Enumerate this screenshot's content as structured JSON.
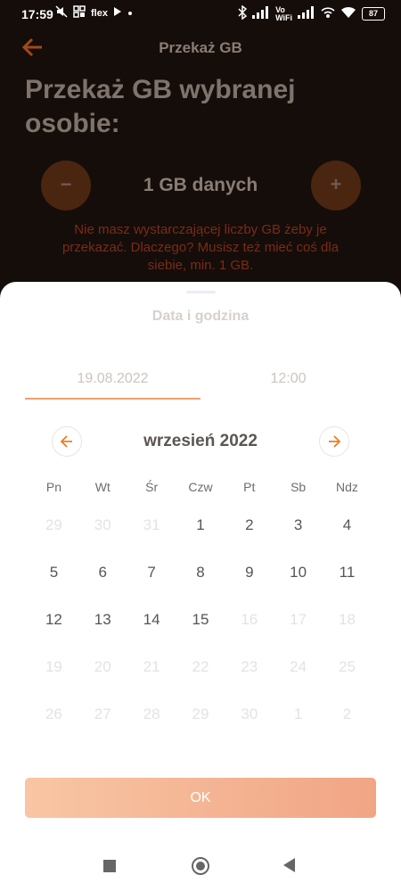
{
  "status_bar": {
    "time": "17:59",
    "carrier_label": "flex",
    "volte_label": "Vo\nWiFi",
    "battery": "87"
  },
  "header": {
    "title": "Przekaż GB"
  },
  "main": {
    "heading": "Przekaż GB wybranej osobie:",
    "minus_label": "−",
    "plus_label": "+",
    "amount": "1 GB danych",
    "warning": "Nie masz wystarczającej liczby GB żeby je przekazać. Dlaczego? Musisz też mieć coś dla siebie, min. 1 GB."
  },
  "sheet": {
    "title": "Data i godzina",
    "date_tab": "19.08.2022",
    "time_tab": "12:00",
    "month": "wrzesień 2022",
    "weekdays": [
      "Pn",
      "Wt",
      "Śr",
      "Czw",
      "Pt",
      "Sb",
      "Ndz"
    ],
    "weeks": [
      [
        "29",
        "30",
        "31",
        "1",
        "2",
        "3",
        "4"
      ],
      [
        "5",
        "6",
        "7",
        "8",
        "9",
        "10",
        "11"
      ],
      [
        "12",
        "13",
        "14",
        "15",
        "16",
        "17",
        "18"
      ],
      [
        "19",
        "20",
        "21",
        "22",
        "23",
        "24",
        "25"
      ],
      [
        "26",
        "27",
        "28",
        "29",
        "30",
        "1",
        "2"
      ]
    ],
    "active": [
      [
        false,
        false,
        false,
        true,
        true,
        true,
        true
      ],
      [
        true,
        true,
        true,
        true,
        true,
        true,
        true
      ],
      [
        true,
        true,
        true,
        true,
        false,
        false,
        false
      ],
      [
        false,
        false,
        false,
        false,
        false,
        false,
        false
      ],
      [
        false,
        false,
        false,
        false,
        false,
        false,
        false
      ]
    ],
    "ok_label": "OK"
  },
  "colors": {
    "accent": "#f07c1b",
    "warning": "#7a2b18",
    "ok_start": "#f8c6a4",
    "ok_end": "#f1a585"
  }
}
